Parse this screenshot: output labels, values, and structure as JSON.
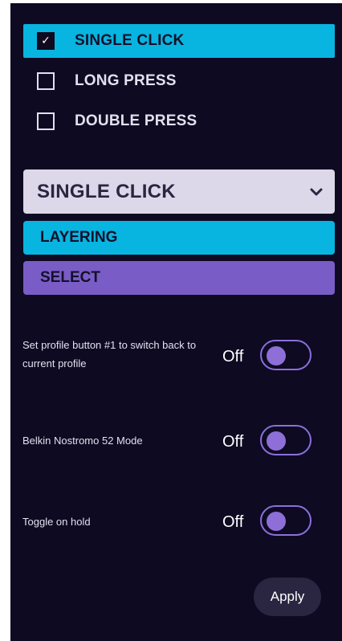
{
  "triggers": [
    {
      "label": "SINGLE CLICK",
      "checked": true
    },
    {
      "label": "LONG PRESS",
      "checked": false
    },
    {
      "label": "DOUBLE PRESS",
      "checked": false
    }
  ],
  "dropdown": {
    "value": "SINGLE CLICK",
    "icon": "chevron-down-icon"
  },
  "options": [
    {
      "label": "LAYERING",
      "color": "#07b5e0"
    },
    {
      "label": "SELECT",
      "color": "#7a5cc6"
    }
  ],
  "settings": [
    {
      "label": "Set profile button #1 to switch back to current profile",
      "state": "Off",
      "on": false
    },
    {
      "label": "Belkin Nostromo 52 Mode",
      "state": "Off",
      "on": false
    },
    {
      "label": "Toggle on hold",
      "state": "Off",
      "on": false
    }
  ],
  "apply_label": "Apply",
  "colors": {
    "background": "#0e0a22",
    "accent_cyan": "#07b5e0",
    "accent_purple": "#7a5cc6",
    "dropdown_bg": "#ddd7ea",
    "button_bg": "#2a2541"
  }
}
